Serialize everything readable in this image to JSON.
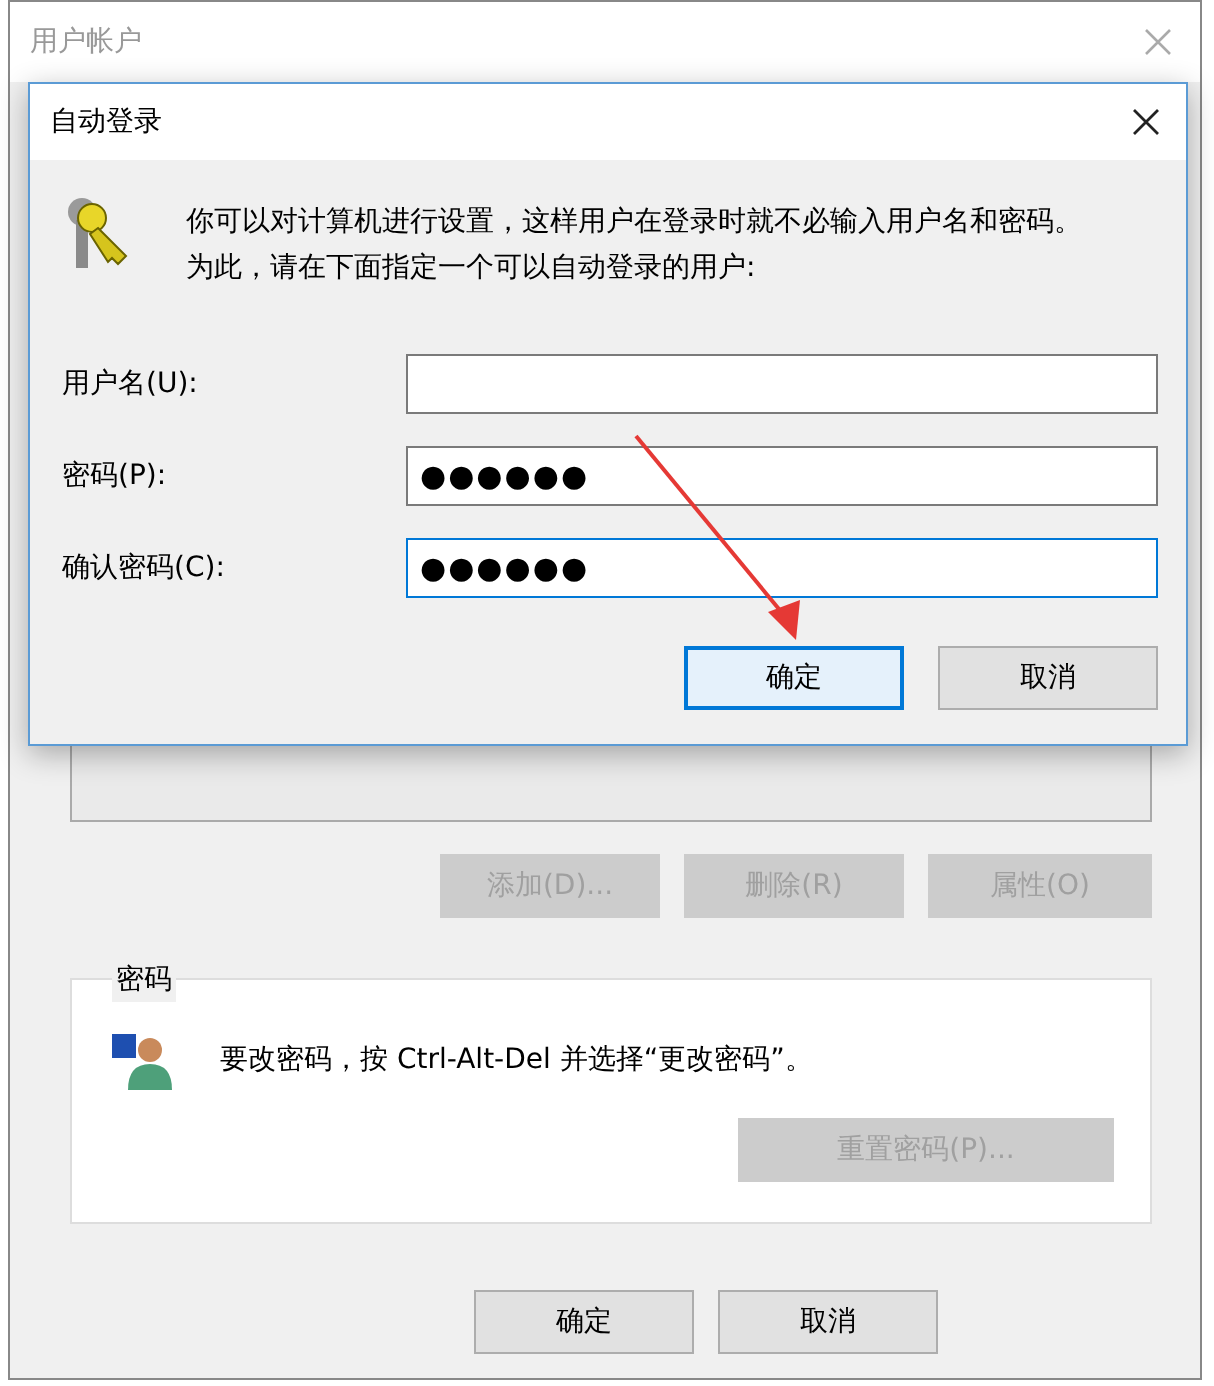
{
  "window": {
    "title": "用户帐户"
  },
  "user_list_buttons": [
    {
      "label": "添加(D)...",
      "disabled": true
    },
    {
      "label": "删除(R)",
      "disabled": true
    },
    {
      "label": "属性(O)",
      "disabled": true
    }
  ],
  "password_group": {
    "title": "密码",
    "message": "要改密码，按 Ctrl-Alt-Del 并选择“更改密码”。",
    "button": {
      "label": "重置密码(P)...",
      "disabled": true
    }
  },
  "footer_buttons": [
    {
      "label": "确定"
    },
    {
      "label": "取消"
    }
  ],
  "dialog": {
    "title": "自动登录",
    "message_lines": [
      "你可以对计算机进行设置，这样用户在登录时就不必输入用户名和密码。",
      "为此，请在下面指定一个可以自动登录的用户:"
    ],
    "fields": [
      {
        "label": "用户名(U):",
        "focused": false
      },
      {
        "label": "密码(P):",
        "value": "●●●●●●",
        "focused": false
      },
      {
        "label": "确认密码(C):",
        "value": "●●●●●●",
        "focused": true
      }
    ],
    "buttons": [
      {
        "label": "确定",
        "focused": true
      },
      {
        "label": "取消",
        "focused": false
      }
    ]
  }
}
